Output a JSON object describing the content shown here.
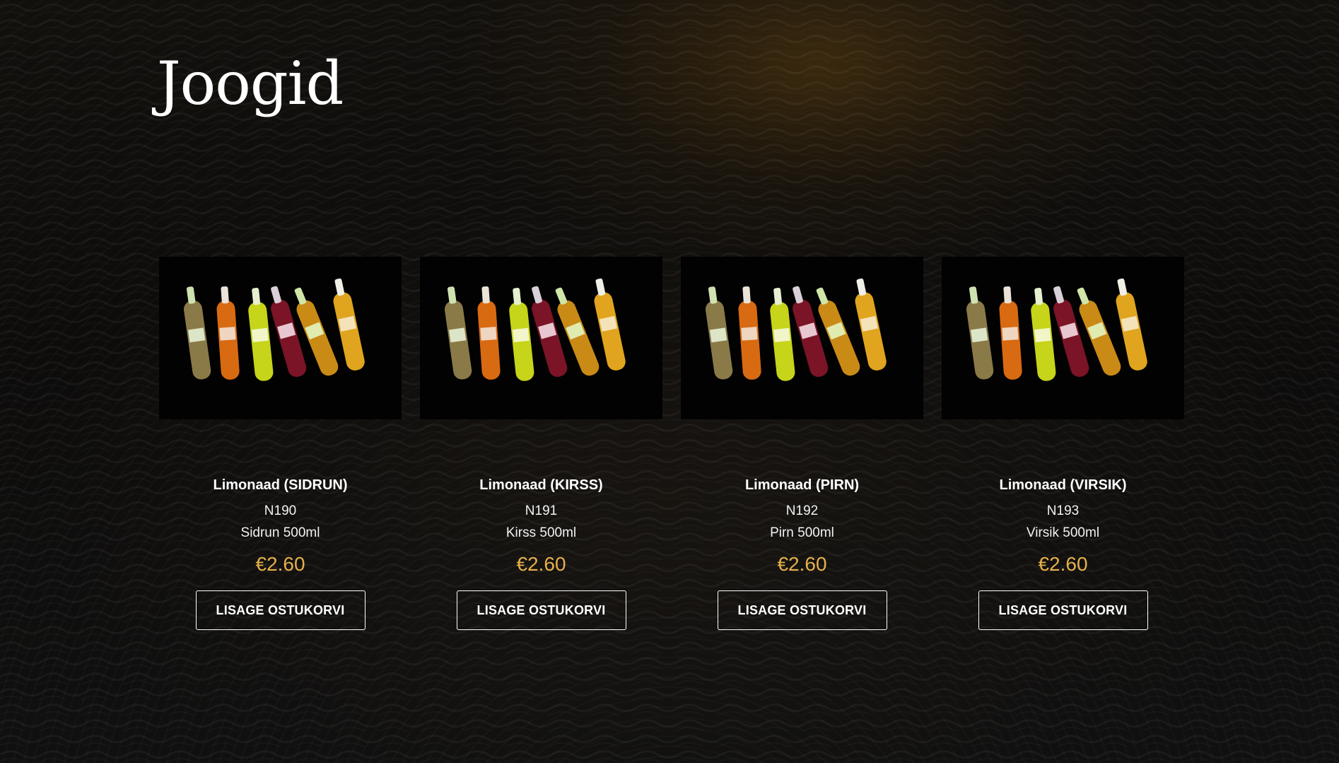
{
  "page": {
    "title": "Joogid",
    "accent_color": "#e6b04a",
    "background_color": "#0c0b0a"
  },
  "products": [
    {
      "name": "Limonaad (SIDRUN)",
      "code": "N190",
      "description": "Sidrun 500ml",
      "price": "€2.60",
      "button_label": "LISAGE OSTUKORVI",
      "image_icon": "lemonade-bottles-image"
    },
    {
      "name": "Limonaad (KIRSS)",
      "code": "N191",
      "description": "Kirss 500ml",
      "price": "€2.60",
      "button_label": "LISAGE OSTUKORVI",
      "image_icon": "lemonade-bottles-image"
    },
    {
      "name": "Limonaad (PIRN)",
      "code": "N192",
      "description": "Pirn 500ml",
      "price": "€2.60",
      "button_label": "LISAGE OSTUKORVI",
      "image_icon": "lemonade-bottles-image"
    },
    {
      "name": "Limonaad (VIRSIK)",
      "code": "N193",
      "description": "Virsik 500ml",
      "price": "€2.60",
      "button_label": "LISAGE OSTUKORVI",
      "image_icon": "lemonade-bottles-image"
    }
  ]
}
